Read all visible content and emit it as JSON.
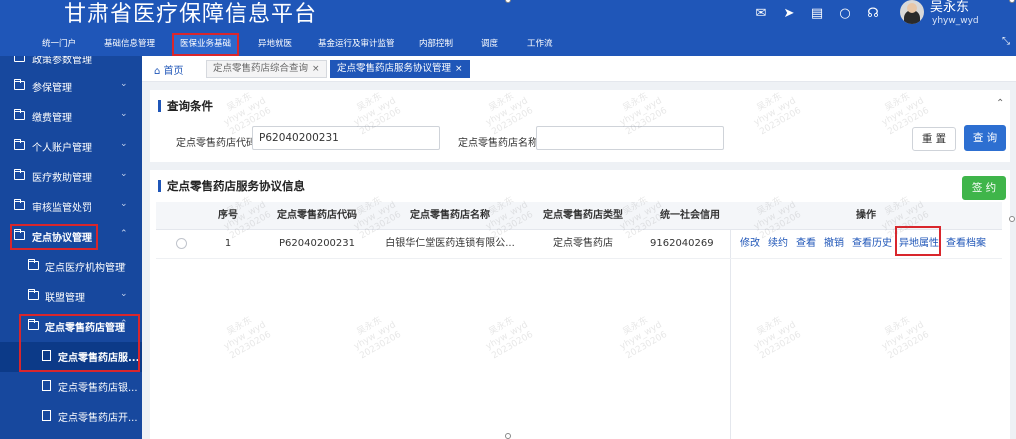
{
  "header": {
    "title": "甘肃省医疗保障信息平台",
    "user_name": "吴永东",
    "user_id": "yhyw_wyd",
    "icons": [
      "mail-icon",
      "send-icon",
      "document-icon",
      "chat-icon",
      "headset-icon"
    ]
  },
  "menu": {
    "items": [
      "统一门户",
      "基础信息管理",
      "医保业务基础",
      "异地就医",
      "基金运行及审计监管",
      "内部控制",
      "调度",
      "工作流"
    ],
    "active_index": 2
  },
  "sidebar": {
    "items": [
      {
        "label": "政策参数管理",
        "level": 1
      },
      {
        "label": "参保管理",
        "level": 1
      },
      {
        "label": "缴费管理",
        "level": 1
      },
      {
        "label": "个人账户管理",
        "level": 1
      },
      {
        "label": "医疗救助管理",
        "level": 1
      },
      {
        "label": "审核监管处罚",
        "level": 1
      },
      {
        "label": "定点协议管理",
        "level": 1,
        "expanded": true
      },
      {
        "label": "定点医疗机构管理",
        "level": 2
      },
      {
        "label": "联盟管理",
        "level": 2
      },
      {
        "label": "定点零售药店管理",
        "level": 2,
        "expanded": true
      },
      {
        "label": "定点零售药店服...",
        "level": 3,
        "selected": true
      },
      {
        "label": "定点零售药店银...",
        "level": 3
      },
      {
        "label": "定点零售药店开...",
        "level": 3
      }
    ]
  },
  "tabs": {
    "home": "首页",
    "items": [
      {
        "label": "定点零售药店综合查询",
        "active": false
      },
      {
        "label": "定点零售药店服务协议管理",
        "active": true
      }
    ]
  },
  "query": {
    "title": "查询条件",
    "code_label": "定点零售药店代码",
    "code_value": "P62040200231",
    "name_label": "定点零售药店名称",
    "name_value": "",
    "reset_label": "重 置",
    "query_label": "查 询"
  },
  "table": {
    "title": "定点零售药店服务协议信息",
    "sign_label": "签 约",
    "columns": [
      "序号",
      "定点零售药店代码",
      "定点零售药店名称",
      "定点零售药店类型",
      "统一社会信用",
      "操作"
    ],
    "rows": [
      {
        "index": "1",
        "code": "P62040200231",
        "name": "白银华仁堂医药连锁有限公...",
        "type": "定点零售药店",
        "credit": "9162040269"
      }
    ],
    "operations": [
      "修改",
      "续约",
      "查看",
      "撤销",
      "查看历史",
      "异地属性",
      "查看档案"
    ]
  },
  "watermark": {
    "line1": "吴永东",
    "line2": "yhyw_wyd",
    "line3": "20230206"
  }
}
